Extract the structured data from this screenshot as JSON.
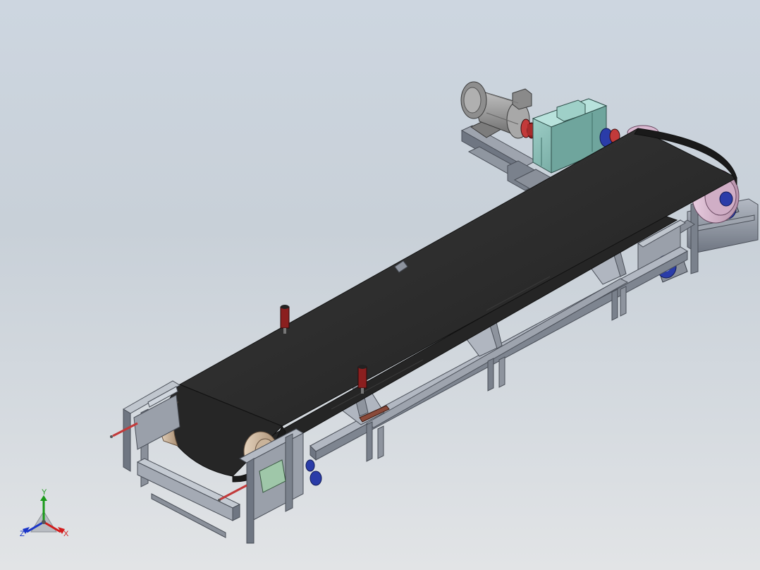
{
  "scene": {
    "model": "belt-conveyor-assembly",
    "background_top": "#cdd6e0",
    "background_bottom": "#e2e4e6",
    "colors": {
      "belt": "#2a2a2a",
      "frame": "#8c929c",
      "motor": "#9a9a9a",
      "gearbox": "#7fb5ad",
      "coupling": "#c23a3a",
      "bearing": "#2a3ca8",
      "drum": "#d9b8d0",
      "tail_drum": "#c9b39a"
    }
  },
  "triad": {
    "y_label": "Y",
    "x_label": "X",
    "z_label": "Z",
    "x_color": "#d21c1c",
    "y_color": "#1a9a1a",
    "z_color": "#1a35c8"
  }
}
